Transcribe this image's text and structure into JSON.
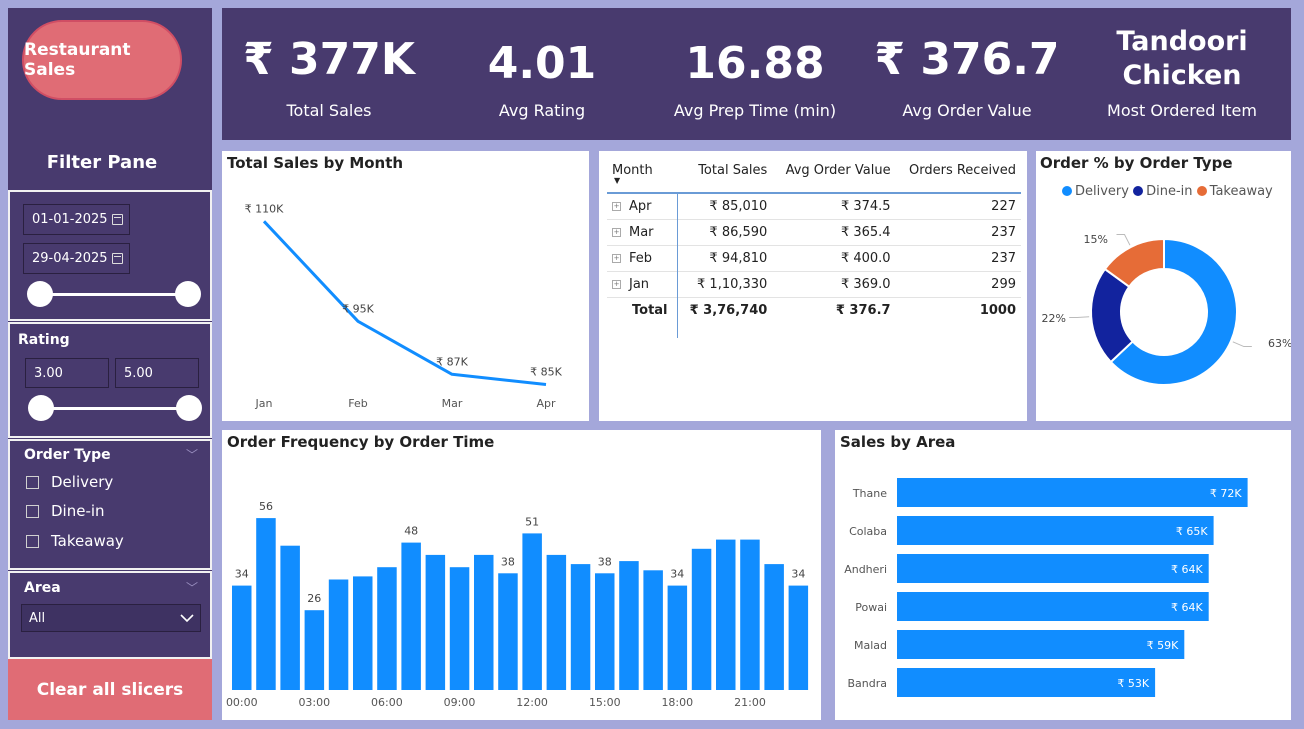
{
  "app": {
    "title_button": "Restaurant Sales",
    "filter_pane_title": "Filter Pane",
    "clear_button": "Clear all slicers"
  },
  "filters": {
    "date_from": "01-01-2025",
    "date_to": "29-04-2025",
    "rating_title": "Rating",
    "rating_min": "3.00",
    "rating_max": "5.00",
    "order_type_title": "Order Type",
    "order_types": [
      "Delivery",
      "Dine-in",
      "Takeaway"
    ],
    "area_title": "Area",
    "area_selected": "All"
  },
  "kpis": [
    {
      "value": "₹ 377K",
      "label": "Total Sales"
    },
    {
      "value": "4.01",
      "label": "Avg Rating"
    },
    {
      "value": "16.88",
      "label": "Avg Prep Time (min)"
    },
    {
      "value": "₹ 376.7",
      "label": "Avg Order Value"
    },
    {
      "value": "Tandoori Chicken",
      "label": "Most Ordered Item"
    }
  ],
  "sales_by_month": {
    "title": "Total Sales by Month",
    "chart_data": {
      "type": "line",
      "categories": [
        "Jan",
        "Feb",
        "Mar",
        "Apr"
      ],
      "values": [
        110330,
        94810,
        86590,
        85010
      ],
      "data_labels": [
        "₹ 110K",
        "₹ 95K",
        "₹ 87K",
        "₹ 85K"
      ],
      "color": "#118dff"
    }
  },
  "month_table": {
    "headers": [
      "Month",
      "Total Sales",
      "Avg Order Value",
      "Orders Received"
    ],
    "rows": [
      [
        "Apr",
        "₹ 85,010",
        "₹ 374.5",
        "227"
      ],
      [
        "Mar",
        "₹ 86,590",
        "₹ 365.4",
        "237"
      ],
      [
        "Feb",
        "₹ 94,810",
        "₹ 400.0",
        "237"
      ],
      [
        "Jan",
        "₹ 1,10,330",
        "₹ 369.0",
        "299"
      ]
    ],
    "total": [
      "Total",
      "₹ 3,76,740",
      "₹ 376.7",
      "1000"
    ]
  },
  "order_type_share": {
    "title": "Order % by Order Type",
    "chart_data": {
      "type": "pie",
      "categories": [
        "Delivery",
        "Dine-in",
        "Takeaway"
      ],
      "values": [
        63,
        22,
        15
      ],
      "labels": [
        "63%",
        "22%",
        "15%"
      ],
      "colors": [
        "#118dff",
        "#12239e",
        "#e66c37"
      ]
    }
  },
  "order_frequency": {
    "title": "Order Frequency by Order Time",
    "chart_data": {
      "type": "bar",
      "x_tick_labels": [
        "00:00",
        "03:00",
        "06:00",
        "09:00",
        "12:00",
        "15:00",
        "18:00",
        "21:00"
      ],
      "values": [
        34,
        56,
        47,
        26,
        36,
        37,
        40,
        48,
        44,
        40,
        44,
        38,
        51,
        44,
        41,
        38,
        42,
        39,
        34,
        46,
        49,
        49,
        41,
        34
      ],
      "data_labels": {
        "0": "34",
        "1": "56",
        "3": "26",
        "7": "48",
        "11": "38",
        "12": "51",
        "15": "38",
        "18": "34",
        "23": "34"
      },
      "ylim": [
        0,
        60
      ],
      "color": "#118dff"
    }
  },
  "sales_by_area": {
    "title": "Sales by Area",
    "chart_data": {
      "type": "bar",
      "orientation": "horizontal",
      "categories": [
        "Thane",
        "Colaba",
        "Andheri",
        "Powai",
        "Malad",
        "Bandra"
      ],
      "values": [
        72,
        65,
        64,
        64,
        59,
        53
      ],
      "data_labels": [
        "₹ 72K",
        "₹ 65K",
        "₹ 64K",
        "₹ 64K",
        "₹ 59K",
        "₹ 53K"
      ],
      "color": "#118dff"
    }
  }
}
